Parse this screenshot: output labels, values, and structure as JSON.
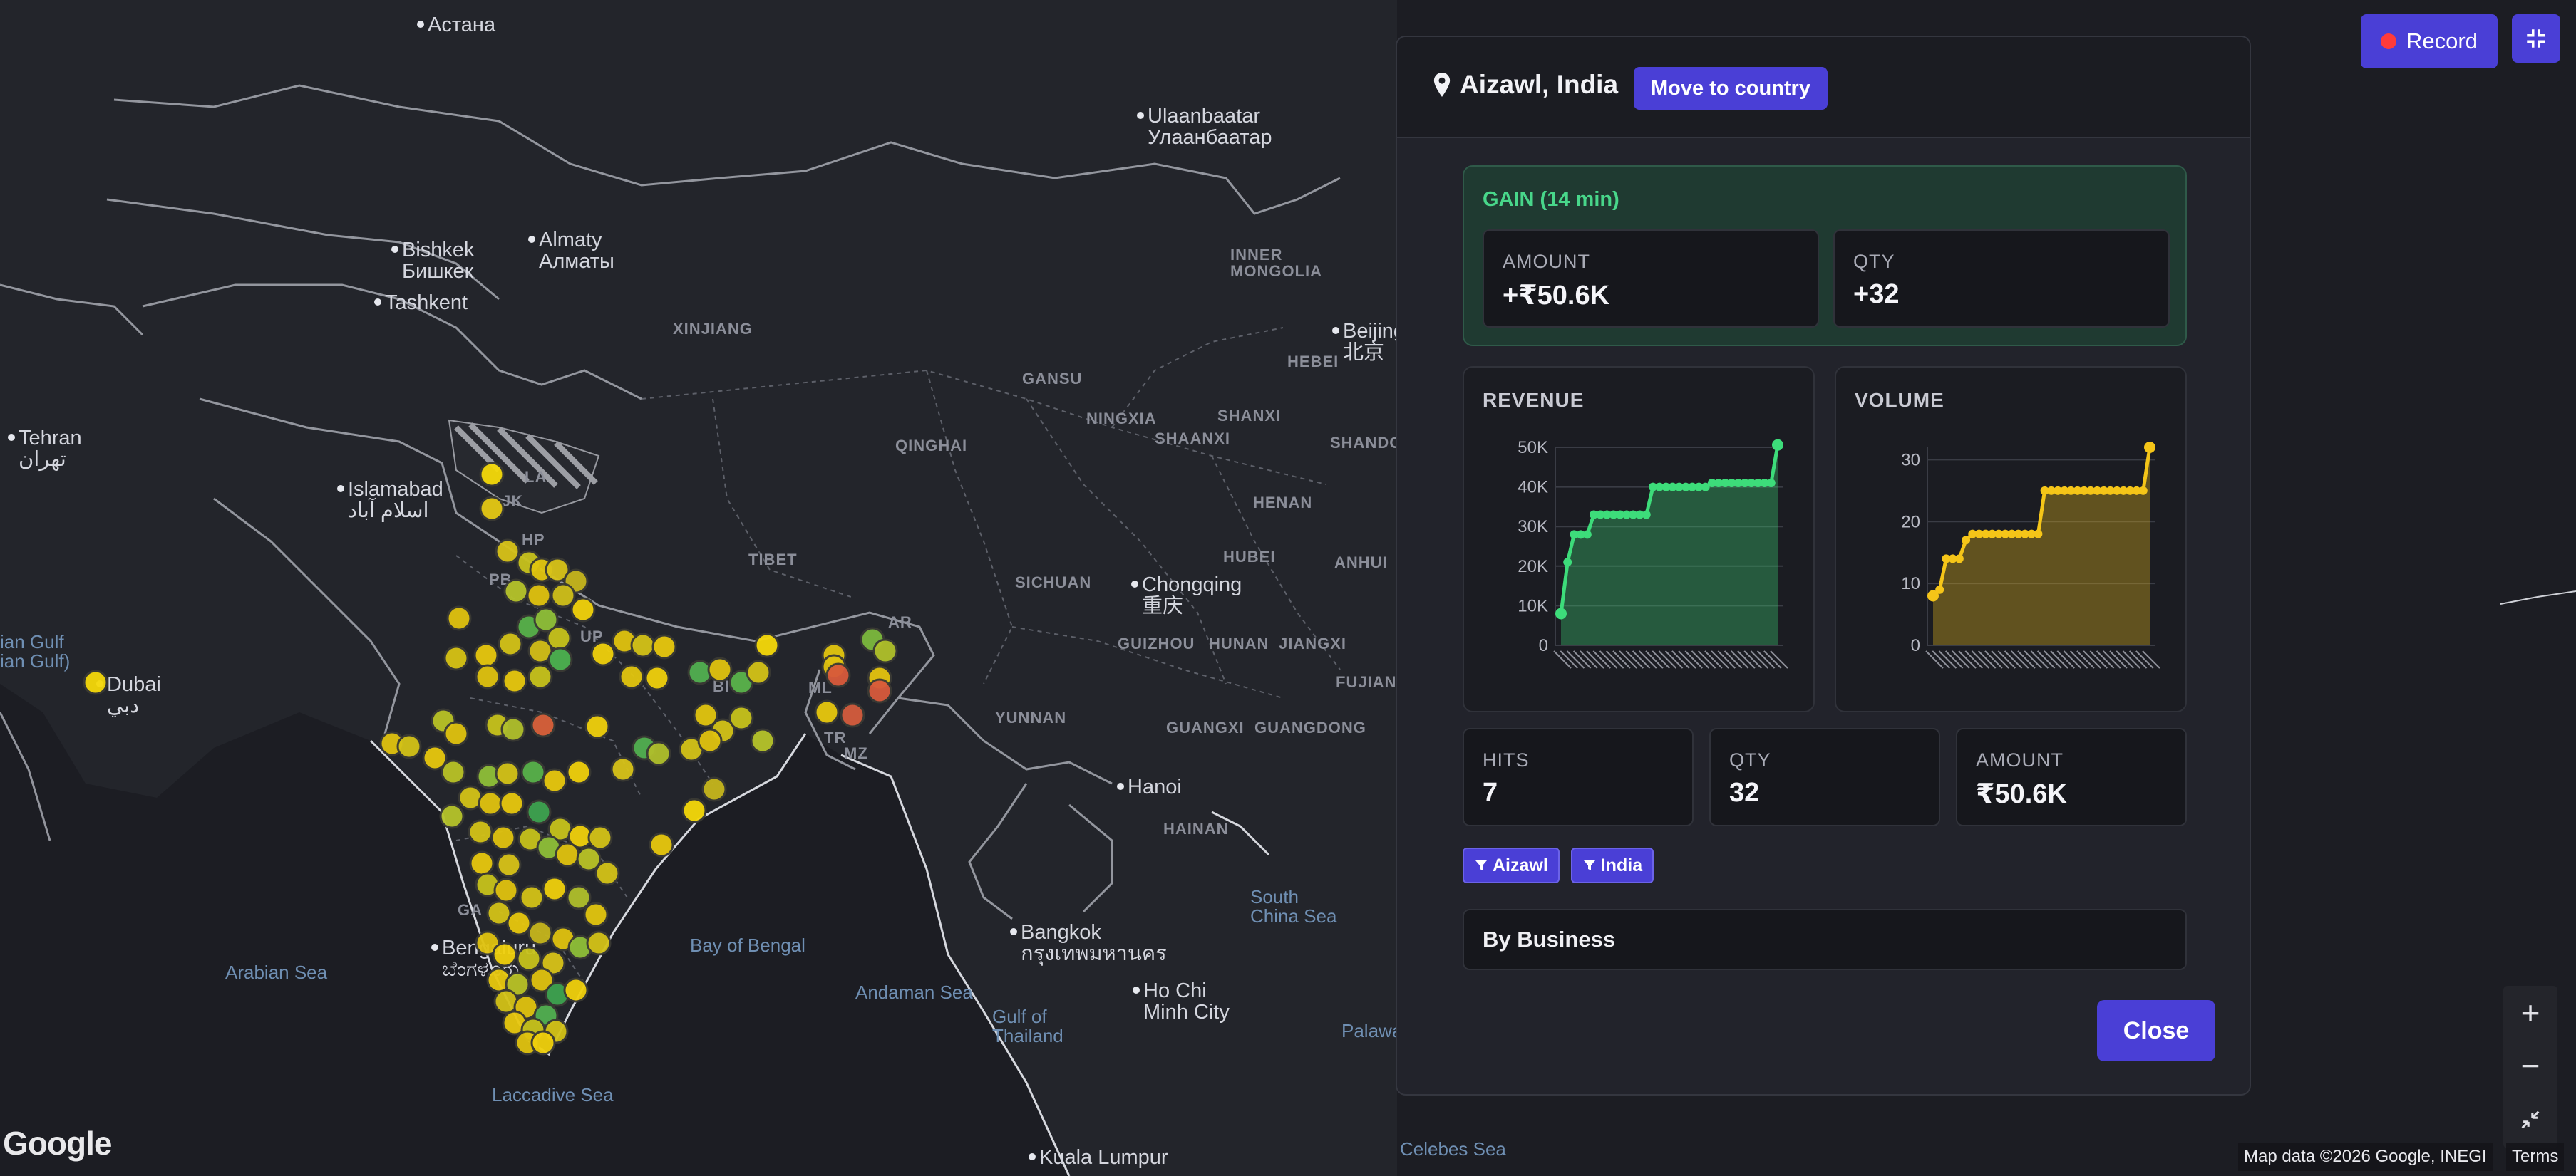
{
  "map": {
    "cities": [
      {
        "name": "Астана",
        "x": 600,
        "y": 20
      },
      {
        "name": "Ulaanbaatar",
        "sub": "Улаанбаатар",
        "x": 1610,
        "y": 148
      },
      {
        "name": "Bishkek",
        "sub": "Бишкек",
        "x": 564,
        "y": 336
      },
      {
        "name": "Almaty",
        "sub": "Алматы",
        "x": 756,
        "y": 322
      },
      {
        "name": "Tashkent",
        "x": 540,
        "y": 410
      },
      {
        "name": "Tehran",
        "sub": "تهران",
        "x": 26,
        "y": 600
      },
      {
        "name": "Islamabad",
        "sub": "اسلام آباد",
        "x": 488,
        "y": 672
      },
      {
        "name": "Dubai",
        "sub": "دبي",
        "x": 150,
        "y": 946
      },
      {
        "name": "Beijing",
        "sub": "北京",
        "x": 1884,
        "y": 450
      },
      {
        "name": "Chongqing",
        "sub": "重庆",
        "x": 1602,
        "y": 806
      },
      {
        "name": "Hanoi",
        "x": 1582,
        "y": 1090
      },
      {
        "name": "Bangkok",
        "sub": "กรุงเทพมหานคร",
        "x": 1432,
        "y": 1294
      },
      {
        "name": "Ho Chi",
        "sub": "Minh City",
        "x": 1604,
        "y": 1376
      },
      {
        "name": "Bengaluru",
        "sub": "ಬೆಂಗಳೂರು",
        "x": 620,
        "y": 1316
      },
      {
        "name": "Kuala Lumpur",
        "x": 1458,
        "y": 1610
      }
    ],
    "regions": [
      {
        "name": "XINJIANG",
        "x": 944,
        "y": 450
      },
      {
        "name": "INNER",
        "sub": "MONGOLIA",
        "x": 1726,
        "y": 346
      },
      {
        "name": "GANSU",
        "x": 1434,
        "y": 520
      },
      {
        "name": "HEBEI",
        "x": 1806,
        "y": 496
      },
      {
        "name": "QINGHAI",
        "x": 1256,
        "y": 614
      },
      {
        "name": "NINGXIA",
        "x": 1524,
        "y": 576
      },
      {
        "name": "SHAANXI",
        "x": 1620,
        "y": 604
      },
      {
        "name": "SHANXI",
        "x": 1708,
        "y": 572
      },
      {
        "name": "SHANDO",
        "x": 1866,
        "y": 610
      },
      {
        "name": "HENAN",
        "x": 1758,
        "y": 694
      },
      {
        "name": "TIBET",
        "x": 1050,
        "y": 774
      },
      {
        "name": "SICHUAN",
        "x": 1424,
        "y": 806
      },
      {
        "name": "HUBEI",
        "x": 1716,
        "y": 770
      },
      {
        "name": "ANHUI",
        "x": 1872,
        "y": 778
      },
      {
        "name": "GUIZHOU",
        "x": 1568,
        "y": 892
      },
      {
        "name": "HUNAN",
        "x": 1696,
        "y": 892
      },
      {
        "name": "JIANGXI",
        "x": 1794,
        "y": 892
      },
      {
        "name": "FUJIAN",
        "x": 1874,
        "y": 946
      },
      {
        "name": "YUNNAN",
        "x": 1396,
        "y": 996
      },
      {
        "name": "GUANGXI",
        "x": 1636,
        "y": 1010
      },
      {
        "name": "GUANGDONG",
        "x": 1760,
        "y": 1010
      },
      {
        "name": "HAINAN",
        "x": 1632,
        "y": 1152
      },
      {
        "name": "HP",
        "x": 732,
        "y": 746
      },
      {
        "name": "PB",
        "x": 686,
        "y": 802
      },
      {
        "name": "UP",
        "x": 814,
        "y": 882
      },
      {
        "name": "AR",
        "x": 1246,
        "y": 862
      },
      {
        "name": "BI",
        "x": 1000,
        "y": 952
      },
      {
        "name": "ML",
        "x": 1134,
        "y": 954
      },
      {
        "name": "TR",
        "x": 1156,
        "y": 1024
      },
      {
        "name": "MZ",
        "x": 1184,
        "y": 1046
      },
      {
        "name": "GA",
        "x": 642,
        "y": 1266
      },
      {
        "name": "LA",
        "x": 736,
        "y": 658
      },
      {
        "name": "JK",
        "x": 704,
        "y": 692
      }
    ],
    "waters": [
      {
        "name": "ian Gulf",
        "sub": "ian Gulf)",
        "x": 0,
        "y": 888
      },
      {
        "name": "Arabian Sea",
        "x": 316,
        "y": 1352
      },
      {
        "name": "Bay of Bengal",
        "x": 968,
        "y": 1314
      },
      {
        "name": "Andaman Sea",
        "x": 1200,
        "y": 1380
      },
      {
        "name": "Gulf of",
        "sub": "Thailand",
        "x": 1392,
        "y": 1414
      },
      {
        "name": "South",
        "sub": "China Sea",
        "x": 1754,
        "y": 1246
      },
      {
        "name": "Laccadive Sea",
        "x": 690,
        "y": 1524
      },
      {
        "name": "Celebes Sea",
        "x": 1964,
        "y": 1600
      },
      {
        "name": "Palawa",
        "x": 1882,
        "y": 1434
      }
    ],
    "markers": [
      {
        "x": 134,
        "y": 958,
        "c": "#f5d90a"
      },
      {
        "x": 690,
        "y": 666,
        "c": "#f5d90a"
      },
      {
        "x": 690,
        "y": 714,
        "c": "#e5c914"
      },
      {
        "x": 712,
        "y": 774,
        "c": "#d8c319"
      },
      {
        "x": 742,
        "y": 790,
        "c": "#c8c21d"
      },
      {
        "x": 760,
        "y": 800,
        "c": "#e2c60f"
      },
      {
        "x": 782,
        "y": 800,
        "c": "#d8c319"
      },
      {
        "x": 808,
        "y": 816,
        "c": "#c6b61d"
      },
      {
        "x": 724,
        "y": 830,
        "c": "#b6c42a"
      },
      {
        "x": 756,
        "y": 836,
        "c": "#e0c30f"
      },
      {
        "x": 790,
        "y": 836,
        "c": "#cfbf1a"
      },
      {
        "x": 818,
        "y": 856,
        "c": "#f2d20b"
      },
      {
        "x": 644,
        "y": 868,
        "c": "#e0c30f"
      },
      {
        "x": 742,
        "y": 880,
        "c": "#58b24a"
      },
      {
        "x": 766,
        "y": 870,
        "c": "#8fbf38"
      },
      {
        "x": 784,
        "y": 896,
        "c": "#c7c21c"
      },
      {
        "x": 640,
        "y": 924,
        "c": "#d7c314"
      },
      {
        "x": 682,
        "y": 920,
        "c": "#e8c80e"
      },
      {
        "x": 716,
        "y": 904,
        "c": "#d3c217"
      },
      {
        "x": 758,
        "y": 914,
        "c": "#d3be18"
      },
      {
        "x": 786,
        "y": 926,
        "c": "#4db24f"
      },
      {
        "x": 846,
        "y": 918,
        "c": "#f0d00c"
      },
      {
        "x": 876,
        "y": 900,
        "c": "#e0c30f"
      },
      {
        "x": 902,
        "y": 906,
        "c": "#d3c217"
      },
      {
        "x": 932,
        "y": 908,
        "c": "#e8c80e"
      },
      {
        "x": 1076,
        "y": 906,
        "c": "#f5d90a"
      },
      {
        "x": 1170,
        "y": 920,
        "c": "#e2c60f"
      },
      {
        "x": 1224,
        "y": 898,
        "c": "#7cb93d"
      },
      {
        "x": 1242,
        "y": 914,
        "c": "#b0c02a"
      },
      {
        "x": 684,
        "y": 950,
        "c": "#e0c30f"
      },
      {
        "x": 722,
        "y": 956,
        "c": "#e8c80e"
      },
      {
        "x": 758,
        "y": 950,
        "c": "#c7c21c"
      },
      {
        "x": 886,
        "y": 950,
        "c": "#e2c60f"
      },
      {
        "x": 922,
        "y": 952,
        "c": "#f0d00c"
      },
      {
        "x": 982,
        "y": 944,
        "c": "#52b050"
      },
      {
        "x": 1010,
        "y": 940,
        "c": "#e0c30f"
      },
      {
        "x": 1040,
        "y": 958,
        "c": "#5ab44b"
      },
      {
        "x": 1064,
        "y": 944,
        "c": "#d3c217"
      },
      {
        "x": 1170,
        "y": 936,
        "c": "#e0c30f"
      },
      {
        "x": 1176,
        "y": 948,
        "c": "#d95a3b"
      },
      {
        "x": 1234,
        "y": 952,
        "c": "#e4c40f"
      },
      {
        "x": 1234,
        "y": 970,
        "c": "#d85a3c"
      },
      {
        "x": 622,
        "y": 1012,
        "c": "#b9c226"
      },
      {
        "x": 640,
        "y": 1030,
        "c": "#e0c30f"
      },
      {
        "x": 698,
        "y": 1018,
        "c": "#c7c21c"
      },
      {
        "x": 720,
        "y": 1024,
        "c": "#b0bf2c"
      },
      {
        "x": 762,
        "y": 1018,
        "c": "#d9603a"
      },
      {
        "x": 838,
        "y": 1020,
        "c": "#f0d00c"
      },
      {
        "x": 990,
        "y": 1004,
        "c": "#e2c60f"
      },
      {
        "x": 1014,
        "y": 1026,
        "c": "#d3c217"
      },
      {
        "x": 1040,
        "y": 1008,
        "c": "#c7c21c"
      },
      {
        "x": 1070,
        "y": 1040,
        "c": "#b6c42a"
      },
      {
        "x": 1160,
        "y": 1000,
        "c": "#e8c80e"
      },
      {
        "x": 1196,
        "y": 1004,
        "c": "#d55c3d"
      },
      {
        "x": 550,
        "y": 1044,
        "c": "#e0c30f"
      },
      {
        "x": 574,
        "y": 1048,
        "c": "#d3c217"
      },
      {
        "x": 610,
        "y": 1064,
        "c": "#e8c80e"
      },
      {
        "x": 636,
        "y": 1084,
        "c": "#b9c226"
      },
      {
        "x": 686,
        "y": 1090,
        "c": "#8fbf38"
      },
      {
        "x": 712,
        "y": 1086,
        "c": "#d3c217"
      },
      {
        "x": 748,
        "y": 1084,
        "c": "#58b24a"
      },
      {
        "x": 778,
        "y": 1096,
        "c": "#e8c80e"
      },
      {
        "x": 812,
        "y": 1084,
        "c": "#f0d00c"
      },
      {
        "x": 874,
        "y": 1080,
        "c": "#d8c319"
      },
      {
        "x": 904,
        "y": 1050,
        "c": "#52b050"
      },
      {
        "x": 924,
        "y": 1058,
        "c": "#b0bf2c"
      },
      {
        "x": 970,
        "y": 1052,
        "c": "#d3c217"
      },
      {
        "x": 996,
        "y": 1040,
        "c": "#e0c30f"
      },
      {
        "x": 974,
        "y": 1138,
        "c": "#f5d90a"
      },
      {
        "x": 1002,
        "y": 1108,
        "c": "#c6b61d"
      },
      {
        "x": 660,
        "y": 1120,
        "c": "#d3c217"
      },
      {
        "x": 688,
        "y": 1128,
        "c": "#e0c30f"
      },
      {
        "x": 634,
        "y": 1146,
        "c": "#b6c42a"
      },
      {
        "x": 718,
        "y": 1128,
        "c": "#e8c80e"
      },
      {
        "x": 756,
        "y": 1140,
        "c": "#3ea34f"
      },
      {
        "x": 786,
        "y": 1164,
        "c": "#c7c21c"
      },
      {
        "x": 814,
        "y": 1174,
        "c": "#f0d00c"
      },
      {
        "x": 842,
        "y": 1176,
        "c": "#d3c217"
      },
      {
        "x": 928,
        "y": 1186,
        "c": "#e8c80e"
      },
      {
        "x": 674,
        "y": 1168,
        "c": "#d3c217"
      },
      {
        "x": 706,
        "y": 1176,
        "c": "#e0c30f"
      },
      {
        "x": 744,
        "y": 1178,
        "c": "#c7c21c"
      },
      {
        "x": 770,
        "y": 1190,
        "c": "#8fbf38"
      },
      {
        "x": 796,
        "y": 1200,
        "c": "#e0c30f"
      },
      {
        "x": 826,
        "y": 1206,
        "c": "#b9c226"
      },
      {
        "x": 852,
        "y": 1226,
        "c": "#d3c217"
      },
      {
        "x": 676,
        "y": 1212,
        "c": "#e8c80e"
      },
      {
        "x": 714,
        "y": 1214,
        "c": "#d8c319"
      },
      {
        "x": 684,
        "y": 1242,
        "c": "#c7c21c"
      },
      {
        "x": 710,
        "y": 1250,
        "c": "#e0c30f"
      },
      {
        "x": 746,
        "y": 1260,
        "c": "#d3c217"
      },
      {
        "x": 778,
        "y": 1248,
        "c": "#f0d00c"
      },
      {
        "x": 812,
        "y": 1260,
        "c": "#b0bf2c"
      },
      {
        "x": 836,
        "y": 1284,
        "c": "#e2c60f"
      },
      {
        "x": 700,
        "y": 1282,
        "c": "#d3c217"
      },
      {
        "x": 728,
        "y": 1296,
        "c": "#e8c80e"
      },
      {
        "x": 758,
        "y": 1310,
        "c": "#c6b61d"
      },
      {
        "x": 790,
        "y": 1318,
        "c": "#e0c30f"
      },
      {
        "x": 814,
        "y": 1330,
        "c": "#8fbf38"
      },
      {
        "x": 840,
        "y": 1324,
        "c": "#d3c217"
      },
      {
        "x": 684,
        "y": 1324,
        "c": "#e0c30f"
      },
      {
        "x": 708,
        "y": 1340,
        "c": "#f0d00c"
      },
      {
        "x": 742,
        "y": 1346,
        "c": "#c7c21c"
      },
      {
        "x": 776,
        "y": 1352,
        "c": "#d8c319"
      },
      {
        "x": 700,
        "y": 1376,
        "c": "#e8c80e"
      },
      {
        "x": 726,
        "y": 1382,
        "c": "#b9c226"
      },
      {
        "x": 760,
        "y": 1376,
        "c": "#e0c30f"
      },
      {
        "x": 782,
        "y": 1396,
        "c": "#3ea34f"
      },
      {
        "x": 808,
        "y": 1390,
        "c": "#f0d00c"
      },
      {
        "x": 710,
        "y": 1406,
        "c": "#d3c217"
      },
      {
        "x": 738,
        "y": 1414,
        "c": "#e0c30f"
      },
      {
        "x": 766,
        "y": 1426,
        "c": "#52b050"
      },
      {
        "x": 722,
        "y": 1436,
        "c": "#e8c80e"
      },
      {
        "x": 748,
        "y": 1446,
        "c": "#c7c21c"
      },
      {
        "x": 780,
        "y": 1448,
        "c": "#d3c217"
      },
      {
        "x": 740,
        "y": 1464,
        "c": "#e0c30f"
      },
      {
        "x": 762,
        "y": 1464,
        "c": "#f0d00c"
      }
    ],
    "attribution": "Map data ©2026 Google, INEGI",
    "terms": "Terms",
    "logo": "Google"
  },
  "controls": {
    "record_label": "Record",
    "zoom_in": "+",
    "zoom_out": "−"
  },
  "panel": {
    "location": "Aizawl, India",
    "move_label": "Move to country",
    "gain": {
      "title": "GAIN (14 min)",
      "amount_label": "AMOUNT",
      "amount_value": "+₹50.6K",
      "qty_label": "QTY",
      "qty_value": "+32"
    },
    "stats": {
      "hits_label": "HITS",
      "hits_value": "7",
      "qty_label": "QTY",
      "qty_value": "32",
      "amount_label": "AMOUNT",
      "amount_value": "₹50.6K"
    },
    "chips": [
      "Aizawl",
      "India"
    ],
    "by_business": "By Business",
    "close_label": "Close"
  },
  "colors": {
    "accent": "#4a3fd6",
    "gain_green": "#48d68a",
    "revenue_line": "#3ddc7a",
    "volume_line": "#f5c518"
  },
  "chart_data": [
    {
      "type": "area",
      "title": "REVENUE",
      "ylim": [
        0,
        50000
      ],
      "yticks": [
        "0",
        "10K",
        "20K",
        "30K",
        "40K",
        "50K"
      ],
      "ytick_values": [
        0,
        10000,
        20000,
        30000,
        40000,
        50000
      ],
      "values": [
        8000,
        21000,
        28000,
        28000,
        28000,
        33000,
        33000,
        33000,
        33000,
        33000,
        33000,
        33000,
        33000,
        33000,
        40000,
        40000,
        40000,
        40000,
        40000,
        40000,
        40000,
        40000,
        40000,
        41000,
        41000,
        41000,
        41000,
        41000,
        41000,
        41000,
        41000,
        41000,
        41000,
        50600
      ],
      "color": "#3ddc7a"
    },
    {
      "type": "area",
      "title": "VOLUME",
      "ylim": [
        0,
        32
      ],
      "yticks": [
        "0",
        "10",
        "20",
        "30"
      ],
      "ytick_values": [
        0,
        10,
        20,
        30
      ],
      "values": [
        8,
        9,
        14,
        14,
        14,
        17,
        18,
        18,
        18,
        18,
        18,
        18,
        18,
        18,
        18,
        18,
        18,
        25,
        25,
        25,
        25,
        25,
        25,
        25,
        25,
        25,
        25,
        25,
        25,
        25,
        25,
        25,
        25,
        32
      ],
      "color": "#f5c518"
    }
  ]
}
